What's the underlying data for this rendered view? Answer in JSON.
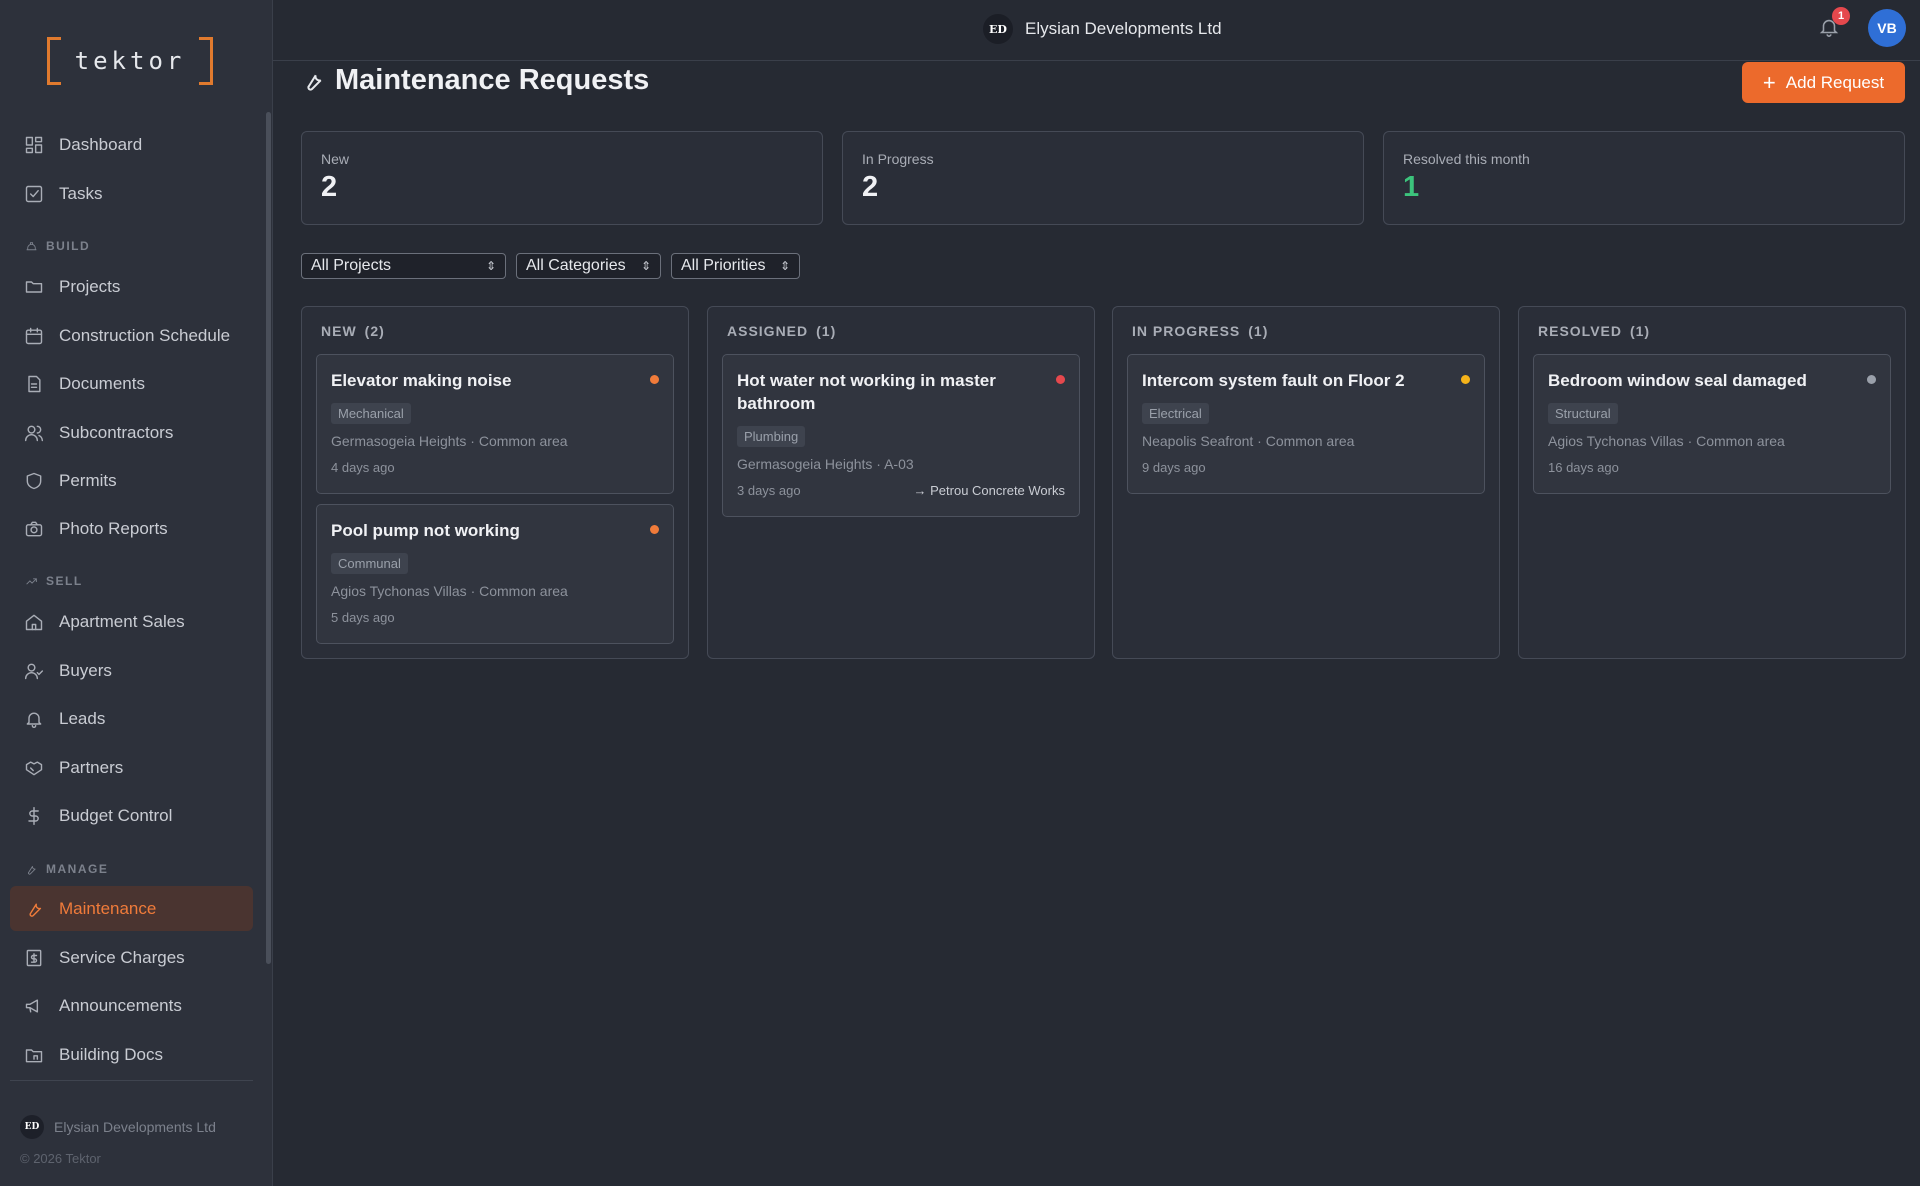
{
  "sidebar": {
    "logo_text": "tektor",
    "items_top": [
      {
        "label": "Dashboard",
        "icon": "dashboard-icon"
      },
      {
        "label": "Tasks",
        "icon": "tasks-icon"
      }
    ],
    "sections": {
      "build": "BUILD",
      "sell": "SELL",
      "manage": "MANAGE"
    },
    "build_items": [
      {
        "label": "Projects"
      },
      {
        "label": "Construction Schedule"
      },
      {
        "label": "Documents"
      },
      {
        "label": "Subcontractors"
      },
      {
        "label": "Permits"
      },
      {
        "label": "Photo Reports"
      }
    ],
    "sell_items": [
      {
        "label": "Apartment Sales"
      },
      {
        "label": "Buyers"
      },
      {
        "label": "Leads"
      },
      {
        "label": "Partners"
      },
      {
        "label": "Budget Control"
      }
    ],
    "manage_items": [
      {
        "label": "Maintenance",
        "active": true
      },
      {
        "label": "Service Charges"
      },
      {
        "label": "Announcements"
      },
      {
        "label": "Building Docs"
      }
    ],
    "org_initials": "ED",
    "org_name": "Elysian Developments Ltd",
    "copyright": "© 2026 Tektor"
  },
  "topbar": {
    "org_initials": "ED",
    "org_name": "Elysian Developments Ltd",
    "notifications_count": "1",
    "user_initials": "VB"
  },
  "page": {
    "title": "Maintenance Requests",
    "add_button": "Add Request"
  },
  "stats": [
    {
      "label": "New",
      "value": "2"
    },
    {
      "label": "In Progress",
      "value": "2"
    },
    {
      "label": "Resolved this month",
      "value": "1"
    }
  ],
  "filters": {
    "project": "All Projects",
    "category": "All Categories",
    "priority": "All Priorities"
  },
  "columns": [
    {
      "title": "NEW",
      "count": "(2)",
      "cards": [
        {
          "title": "Elevator making noise",
          "category": "Mechanical",
          "location": "Germasogeia Heights · Common area",
          "age": "4 days ago",
          "priority_color": "#f07b3a"
        },
        {
          "title": "Pool pump not working",
          "category": "Communal",
          "location": "Agios Tychonas Villas · Common area",
          "age": "5 days ago",
          "priority_color": "#f07b3a"
        }
      ]
    },
    {
      "title": "ASSIGNED",
      "count": "(1)",
      "cards": [
        {
          "title": "Hot water not working in master bathroom",
          "category": "Plumbing",
          "location": "Germasogeia Heights · A-03",
          "age": "3 days ago",
          "assignee": "→ Petrou Concrete Works",
          "priority_color": "#e5484d"
        }
      ]
    },
    {
      "title": "IN PROGRESS",
      "count": "(1)",
      "cards": [
        {
          "title": "Intercom system fault on Floor 2",
          "category": "Electrical",
          "location": "Neapolis Seafront · Common area",
          "age": "9 days ago",
          "priority_color": "#f5b31a"
        }
      ]
    },
    {
      "title": "RESOLVED",
      "count": "(1)",
      "cards": [
        {
          "title": "Bedroom window seal damaged",
          "category": "Structural",
          "location": "Agios Tychonas Villas · Common area",
          "age": "16 days ago",
          "priority_color": "#9aa0aa"
        }
      ]
    }
  ]
}
